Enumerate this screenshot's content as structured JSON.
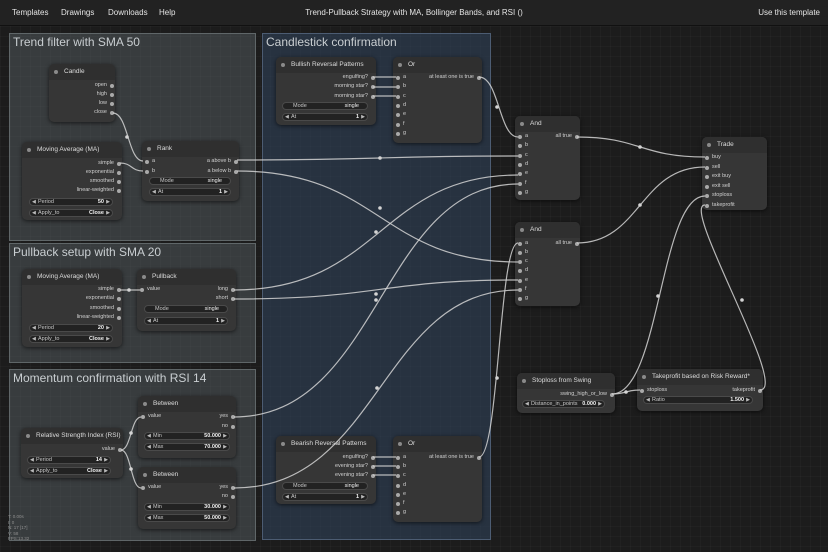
{
  "menu": {
    "templates": "Templates",
    "drawings": "Drawings",
    "downloads": "Downloads",
    "help": "Help",
    "title": "Trend-Pullback Strategy with MA, Bollinger Bands, and RSI ()",
    "use_template": "Use this template"
  },
  "groups": {
    "trend": "Trend filter with SMA 50",
    "candlestick": "Candlestick confirmation",
    "pullback": "Pullback setup with SMA 20",
    "momentum": "Momentum confirmation with RSI 14"
  },
  "candle": {
    "title": "Candle",
    "open": "open",
    "high": "high",
    "low": "low",
    "close": "close"
  },
  "ma50": {
    "title": "Moving Average (MA)",
    "simple": "simple",
    "exponential": "exponential",
    "smoothed": "smoothed",
    "linear_weighted": "linear-weighted",
    "period_label": "Period",
    "period_value": "50",
    "apply_label": "Apply_to",
    "apply_value": "Close"
  },
  "rank": {
    "title": "Rank",
    "a": "a",
    "b": "b",
    "above": "a above b",
    "below": "a below b",
    "mode_label": "Mode",
    "mode_value": "single",
    "at_label": "At",
    "at_value": "1"
  },
  "ma20": {
    "title": "Moving Average (MA)",
    "simple": "simple",
    "exponential": "exponential",
    "smoothed": "smoothed",
    "linear_weighted": "linear-weighted",
    "period_label": "Period",
    "period_value": "20",
    "apply_label": "Apply_to",
    "apply_value": "Close"
  },
  "pullback": {
    "title": "Pullback",
    "value": "value",
    "long": "long",
    "short": "short",
    "mode_label": "Mode",
    "mode_value": "single",
    "at_label": "At",
    "at_value": "1"
  },
  "rsi": {
    "title": "Relative Strength Index (RSI)",
    "value": "value",
    "period_label": "Period",
    "period_value": "14",
    "apply_label": "Apply_to",
    "apply_value": "Close"
  },
  "between1": {
    "title": "Between",
    "value": "value",
    "yes": "yes",
    "no": "no",
    "min_label": "Min",
    "min_value": "50.000",
    "max_label": "Max",
    "max_value": "70.000"
  },
  "between2": {
    "title": "Between",
    "value": "value",
    "yes": "yes",
    "no": "no",
    "min_label": "Min",
    "min_value": "30.000",
    "max_label": "Max",
    "max_value": "50.000"
  },
  "bullish": {
    "title": "Bullish Reversal Patterns",
    "engulfing": "engulfing?",
    "morning_star1": "morning star?",
    "morning_star2": "morning star?",
    "mode_label": "Mode",
    "mode_value": "single",
    "at_label": "At",
    "at_value": "1"
  },
  "bearish": {
    "title": "Bearish Reversal Patterns",
    "engulfing": "engulfing?",
    "evening_star1": "evening star?",
    "evening_star2": "evening star?",
    "mode_label": "Mode",
    "mode_value": "single",
    "at_label": "At",
    "at_value": "1"
  },
  "or_node": {
    "title": "Or",
    "out": "at least one is true",
    "inputs": [
      "a",
      "b",
      "c",
      "d",
      "e",
      "f",
      "g"
    ]
  },
  "and_node": {
    "title": "And",
    "out": "all true",
    "inputs": [
      "a",
      "b",
      "c",
      "d",
      "e",
      "f",
      "g"
    ]
  },
  "trade": {
    "title": "Trade",
    "buy": "buy",
    "sell": "sell",
    "exit_buy": "exit buy",
    "exit_sell": "exit sell",
    "stoploss": "stoploss",
    "takeprofit": "takeprofit"
  },
  "swing": {
    "title": "Stoploss from Swing",
    "out": "swing_high_or_low",
    "dist_label": "Distance_in_points",
    "dist_value": "0.000"
  },
  "tp": {
    "title": "Takeprofit based on Risk Reward*",
    "stoploss": "stoploss",
    "takeprofit": "takeprofit",
    "ratio_label": "Ratio",
    "ratio_value": "1.500"
  },
  "stats": [
    "T: 0.00s",
    "I: 0",
    "N: 17 [17]",
    "V: 58",
    "FPS:13.32"
  ]
}
